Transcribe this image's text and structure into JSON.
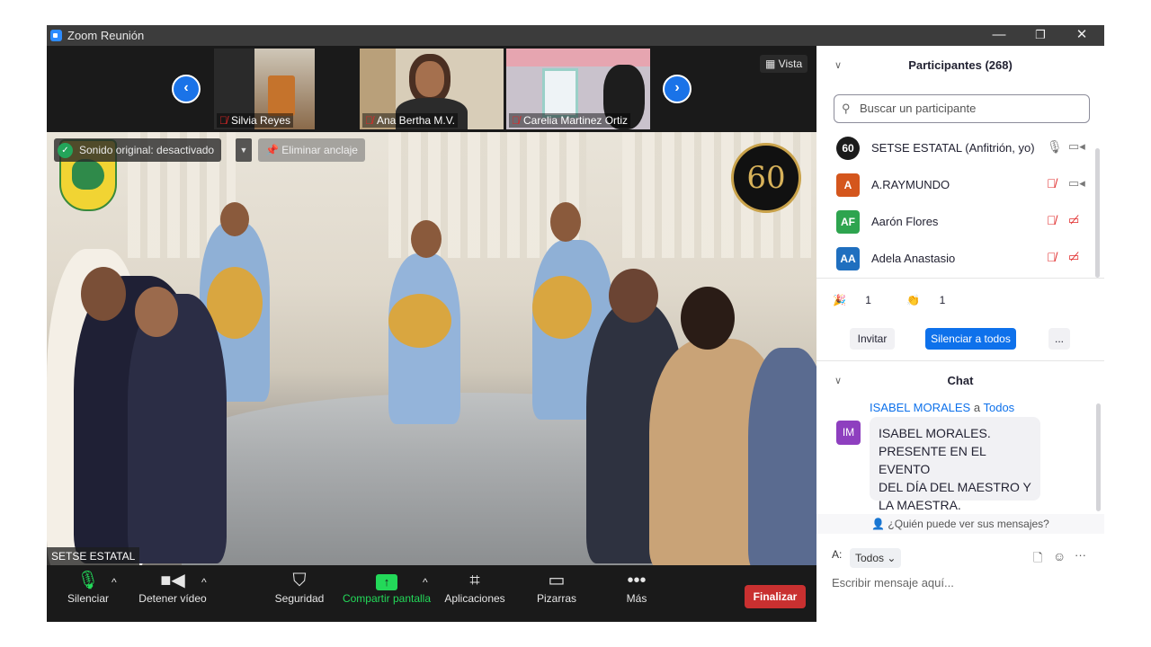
{
  "window": {
    "title": "Zoom Reunión",
    "minimize_glyph": "—",
    "restore_glyph": "❐",
    "close_glyph": "✕"
  },
  "strip": {
    "prev_icon": "chevron-left-icon",
    "next_icon": "chevron-right-icon",
    "thumbnails": [
      {
        "name": "Silvia Reyes"
      },
      {
        "name": "Ana Bertha M.V."
      },
      {
        "name": "Carelia Martinez Ortiz"
      }
    ],
    "view_label": "Vista"
  },
  "main_video": {
    "sound_banner": "Sonido original: desactivado",
    "unpin_label": "Eliminar anclaje",
    "speaker_name": "SETSE ESTATAL",
    "logo_text": "60"
  },
  "toolbar": {
    "mute_label": "Silenciar",
    "video_label": "Detener vídeo",
    "security_label": "Seguridad",
    "share_label": "Compartir pantalla",
    "apps_label": "Aplicaciones",
    "whiteboards_label": "Pizarras",
    "more_label": "Más",
    "end_label": "Finalizar"
  },
  "participants": {
    "header": "Participantes (268)",
    "search_placeholder": "Buscar un participante",
    "list": [
      {
        "initials": "60",
        "name": "SETSE ESTATAL (Anfitrión, yo)",
        "color": "#1b1b1b",
        "mic_muted": false,
        "cam_off": false
      },
      {
        "initials": "A",
        "name": "A.RAYMUNDO",
        "color": "#d4561d",
        "mic_muted": true,
        "cam_off": false
      },
      {
        "initials": "AF",
        "name": "Aarón Flores",
        "color": "#2ea44f",
        "mic_muted": true,
        "cam_off": true
      },
      {
        "initials": "AA",
        "name": "Adela Anastasio",
        "color": "#1f6fbf",
        "mic_muted": true,
        "cam_off": true
      }
    ],
    "reactions": [
      {
        "emoji": "🎉",
        "count": "1"
      },
      {
        "emoji": "👏",
        "count": "1"
      }
    ],
    "invite_label": "Invitar",
    "mute_all_label": "Silenciar a todos",
    "more_label": "..."
  },
  "chat": {
    "header": "Chat",
    "sender": "ISABEL MORALES",
    "to_word": "a",
    "recipient": "Todos",
    "avatar_initials": "IM",
    "message": "ISABEL MORALES.\nPRESENTE EN EL EVENTO\nDEL DÍA DEL MAESTRO Y\nLA  MAESTRA.",
    "who_sees": "¿Quién puede ver sus mensajes?",
    "to_label": "A:",
    "to_value": "Todos",
    "composer_placeholder": "Escribir mensaje aquí..."
  },
  "colors": {
    "accent": "#0e71eb",
    "end_red": "#c93030",
    "toolbar_bg": "#1a1a1a",
    "share_green": "#23d959"
  }
}
